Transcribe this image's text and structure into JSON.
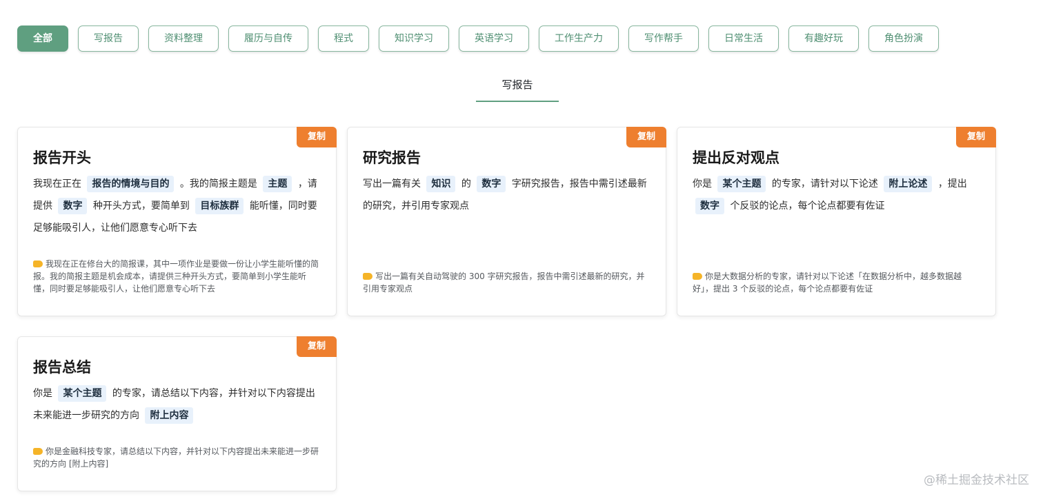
{
  "filters": [
    {
      "label": "全部",
      "active": true
    },
    {
      "label": "写报告"
    },
    {
      "label": "资料整理"
    },
    {
      "label": "履历与自传"
    },
    {
      "label": "程式"
    },
    {
      "label": "知识学习"
    },
    {
      "label": "英语学习"
    },
    {
      "label": "工作生产力"
    },
    {
      "label": "写作帮手"
    },
    {
      "label": "日常生活"
    },
    {
      "label": "有趣好玩"
    },
    {
      "label": "角色扮演"
    }
  ],
  "section": {
    "title": "写报告"
  },
  "copy_label": "复制",
  "cards": [
    {
      "title": "报告开头",
      "prompt": {
        "t1": "我现在正在",
        "p1": "报告的情境与目的",
        "t2": "。我的简报主题是",
        "p2": "主题",
        "t3": "，请提供",
        "p3": "数字",
        "t4": "种开头方式，要简单到",
        "p4": "目标族群",
        "t5": "能听懂，同时要足够能吸引人，让他们愿意专心听下去"
      },
      "example": "我现在正在修台大的简报课，其中一项作业是要做一份让小学生能听懂的简报。我的简报主题是机会成本，请提供三种开头方式，要简单到小学生能听懂，同时要足够能吸引人，让他们愿意专心听下去"
    },
    {
      "title": "研究报告",
      "prompt": {
        "t1": "写出一篇有关",
        "p1": "知识",
        "t2": "的",
        "p2": "数字",
        "t3": "字研究报告，报告中需引述最新的研究，并引用专家观点"
      },
      "example": "写出一篇有关自动驾驶的 300 字研究报告，报告中需引述最新的研究，并引用专家观点"
    },
    {
      "title": "提出反对观点",
      "prompt": {
        "t1": "你是",
        "p1": "某个主题",
        "t2": "的专家，请针对以下论述",
        "p2": "附上论述",
        "t3": "，提出",
        "p3": "数字",
        "t4": "个反驳的论点，每个论点都要有佐证"
      },
      "example": "你是大数据分析的专家，请针对以下论述「在数据分析中，越多数据越好」，提出 3 个反驳的论点，每个论点都要有佐证"
    },
    {
      "title": "报告总结",
      "prompt": {
        "t1": "你是",
        "p1": "某个主题",
        "t2": "的专家，请总结以下内容，并针对以下内容提出未来能进一步研究的方向",
        "p2": "附上内容"
      },
      "example": "你是金融科技专家，请总结以下内容，并针对以下内容提出未来能进一步研究的方向 [附上内容]"
    }
  ],
  "watermark": "@稀土掘金技术社区"
}
